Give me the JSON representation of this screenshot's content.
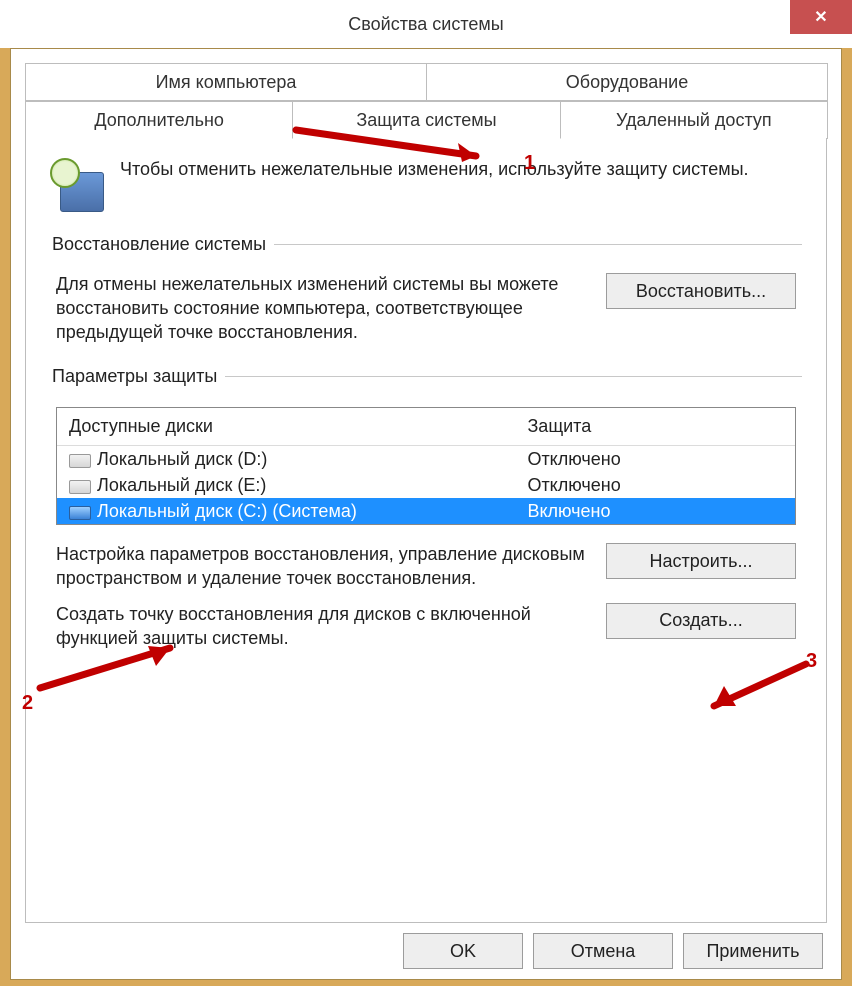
{
  "title": "Свойства системы",
  "close_label": "✕",
  "tabs": {
    "row1": [
      "Имя компьютера",
      "Оборудование"
    ],
    "row2": [
      "Дополнительно",
      "Защита системы",
      "Удаленный доступ"
    ],
    "active": "Защита системы"
  },
  "intro": "Чтобы отменить нежелательные изменения, используйте защиту системы.",
  "restore": {
    "legend": "Восстановление системы",
    "text": "Для отмены нежелательных изменений системы вы можете восстановить состояние компьютера, соответствующее предыдущей точке восстановления.",
    "button": "Восстановить..."
  },
  "protection": {
    "legend": "Параметры защиты",
    "col_name": "Доступные диски",
    "col_prot": "Защита",
    "rows": [
      {
        "name": "Локальный диск (D:)",
        "prot": "Отключено",
        "system": false,
        "selected": false
      },
      {
        "name": "Локальный диск (E:)",
        "prot": "Отключено",
        "system": false,
        "selected": false
      },
      {
        "name": "Локальный диск (C:) (Система)",
        "prot": "Включено",
        "system": true,
        "selected": true
      }
    ],
    "configure_text": "Настройка параметров восстановления, управление дисковым пространством и удаление точек восстановления.",
    "configure_button": "Настроить...",
    "create_text": "Создать точку восстановления для дисков с включенной функцией защиты системы.",
    "create_button": "Создать..."
  },
  "buttons": {
    "ok": "OK",
    "cancel": "Отмена",
    "apply": "Применить"
  },
  "annotations": {
    "n1": "1",
    "n2": "2",
    "n3": "3"
  }
}
